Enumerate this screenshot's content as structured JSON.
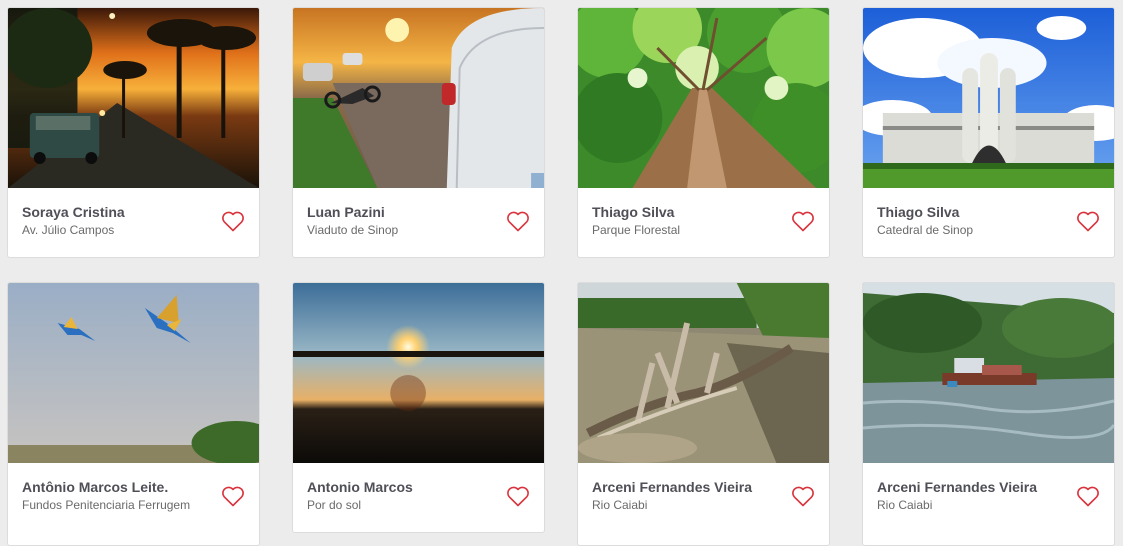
{
  "colors": {
    "heart": "#d9343d",
    "author": "#4f4f57",
    "place": "#6a6a6a",
    "background": "#ececec"
  },
  "cards": [
    {
      "author": "Soraya Cristina",
      "place": "Av. Júlio Campos",
      "icon": "heart-outline-icon",
      "photo": "sunset-avenue-with-palms-and-car"
    },
    {
      "author": "Luan Pazini",
      "place": "Viaduto de Sinop",
      "icon": "heart-outline-icon",
      "photo": "sunset-road-with-motorcycle-and-car"
    },
    {
      "author": "Thiago Silva",
      "place": "Parque Florestal",
      "icon": "heart-outline-icon",
      "photo": "tree-trunk-and-canopy"
    },
    {
      "author": "Thiago Silva",
      "place": "Catedral de Sinop",
      "icon": "heart-outline-icon",
      "photo": "cathedral-under-blue-sky"
    },
    {
      "author": "Antônio Marcos Leite.",
      "place": "Fundos Penitenciaria Ferrugem",
      "icon": "heart-outline-icon",
      "photo": "macaws-flying-over-field"
    },
    {
      "author": "Antonio Marcos",
      "place": "Por do sol",
      "icon": "heart-outline-icon",
      "photo": "sunset-over-dark-field"
    },
    {
      "author": "Arceni Fernandes Vieira",
      "place": "Rio Caiabi",
      "icon": "heart-outline-icon",
      "photo": "driftwood-in-river"
    },
    {
      "author": "Arceni Fernandes Vieira",
      "place": "Rio Caiabi",
      "icon": "heart-outline-icon",
      "photo": "dredge-boat-on-river"
    }
  ]
}
